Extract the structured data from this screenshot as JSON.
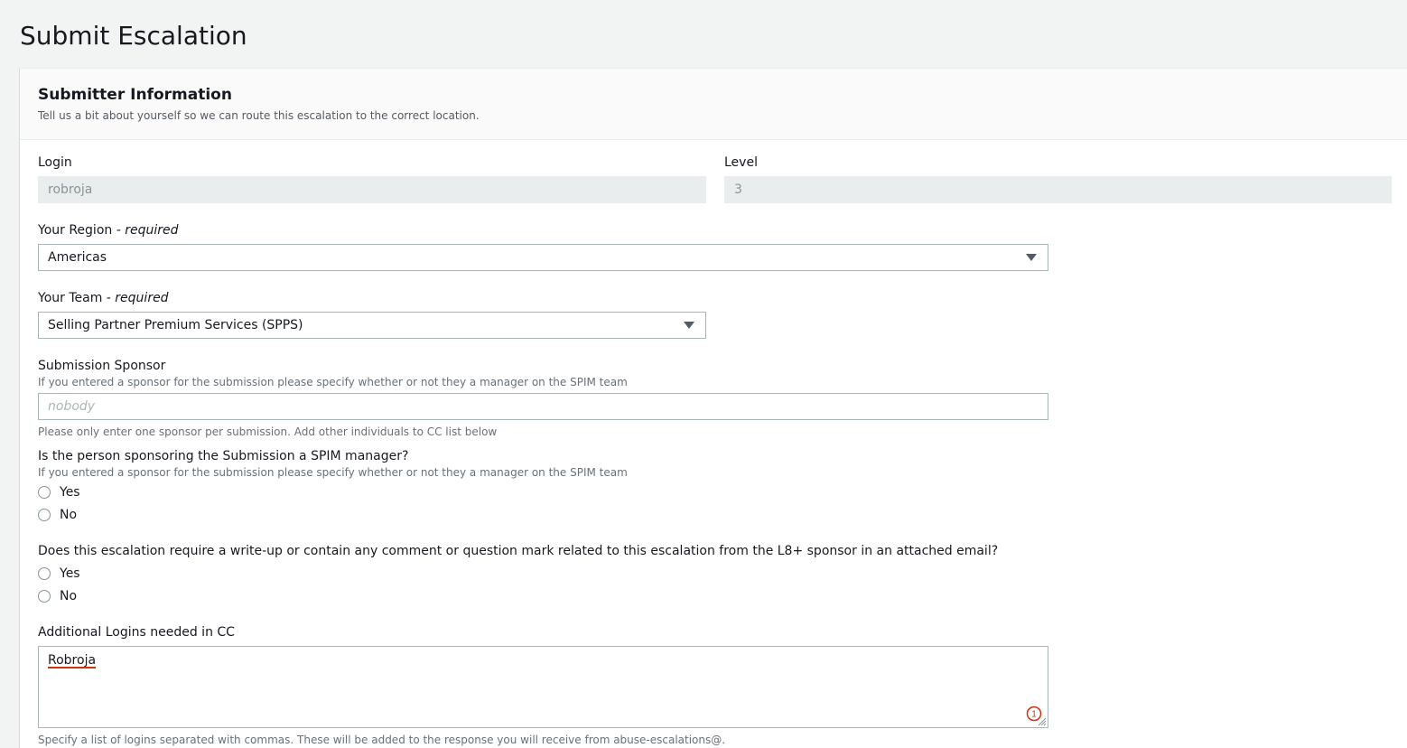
{
  "page": {
    "title": "Submit Escalation"
  },
  "section": {
    "title": "Submitter Information",
    "description": "Tell us a bit about yourself so we can route this escalation to the correct location."
  },
  "login": {
    "label": "Login",
    "value": "robroja"
  },
  "level": {
    "label": "Level",
    "value": "3"
  },
  "region": {
    "label": "Your Region",
    "required": " - required",
    "value": "Americas"
  },
  "team": {
    "label": "Your Team",
    "required": " - required",
    "value": "Selling Partner Premium Services (SPPS)"
  },
  "sponsor": {
    "label": "Submission Sponsor",
    "description": "If you entered a sponsor for the submission please specify whether or not they a manager on the SPIM team",
    "placeholder": "nobody",
    "hint": "Please only enter one sponsor per submission. Add other individuals to CC list below"
  },
  "spim_manager": {
    "label": "Is the person sponsoring the Submission a SPIM manager?",
    "description": "If you entered a sponsor for the submission please specify whether or not they a manager on the SPIM team",
    "options": [
      "Yes",
      "No"
    ]
  },
  "writeup": {
    "label": "Does this escalation require a write-up or contain any comment or question mark related to this escalation from the L8+ sponsor in an attached email?",
    "options": [
      "Yes",
      "No"
    ]
  },
  "cc": {
    "label": "Additional Logins needed in CC",
    "value": "Robroja",
    "hint": "Specify a list of logins separated with commas. These will be added to the response you will receive from abuse-escalations@.",
    "badge_count": "1"
  },
  "colors": {
    "background": "#f2f3f3",
    "panel": "#ffffff",
    "header": "#fafafa",
    "border": "#aab7b8",
    "disabled": "#eaeded",
    "spellcheck": "#d13212"
  }
}
